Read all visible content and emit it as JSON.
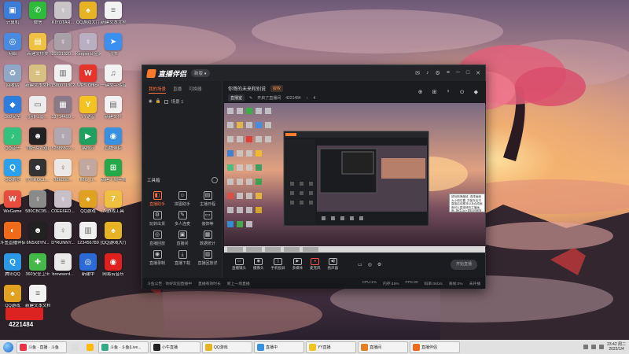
{
  "desktop": {
    "icons": [
      {
        "label": "计算机",
        "color": "#3b7dd8",
        "glyph": "▣"
      },
      {
        "label": "微信",
        "color": "#2dbb3c",
        "glyph": "✆"
      },
      {
        "label": "KIYOTAR...",
        "color": "#c9c3c8",
        "glyph": "♀"
      },
      {
        "label": "QQ游戏大厅",
        "color": "#e6b422",
        "glyph": "♠"
      },
      {
        "label": "新建文本文档",
        "color": "#f2f2f2",
        "glyph": "≡"
      },
      {
        "label": "网络",
        "color": "#4a8ae0",
        "glyph": "◎"
      },
      {
        "label": "新建文件夹",
        "color": "#f0c040",
        "glyph": "▤"
      },
      {
        "label": "20231020...",
        "color": "#aaa0a8",
        "glyph": "♀"
      },
      {
        "label": "Keeper合金装备合集",
        "color": "#b8b0c0",
        "glyph": "♀"
      },
      {
        "label": "飞书",
        "color": "#3a8ff0",
        "glyph": "➤"
      },
      {
        "label": "回收站",
        "color": "#8fa8c8",
        "glyph": "♻"
      },
      {
        "label": "新建文本文档 (2)",
        "color": "#d8c080",
        "glyph": "≡"
      },
      {
        "label": "1580071802",
        "color": "#f0f0f0",
        "glyph": "▥"
      },
      {
        "label": "WPS Office",
        "color": "#e8332a",
        "glyph": "W"
      },
      {
        "label": "一键文字转音频",
        "color": "#f2f2f2",
        "glyph": "♫"
      },
      {
        "label": "360安全",
        "color": "#2c7de0",
        "glyph": "◆"
      },
      {
        "label": "[闪]FL@...",
        "color": "#ececec",
        "glyph": "▭"
      },
      {
        "label": "13714499...",
        "color": "#8a7a88",
        "glyph": "▦"
      },
      {
        "label": "YY语音",
        "color": "#f3c420",
        "glyph": "Y"
      },
      {
        "label": "新建文件",
        "color": "#f2f2f2",
        "glyph": "▤"
      },
      {
        "label": "QQ音乐",
        "color": "#31c27c",
        "glyph": "♪"
      },
      {
        "label": "你好,R7(双)",
        "color": "#222222",
        "glyph": "☻"
      },
      {
        "label": "82888822...",
        "color": "#b0a8b0",
        "glyph": "♀"
      },
      {
        "label": "喀秋莎",
        "color": "#20a060",
        "glyph": "▶"
      },
      {
        "label": "直播伴侣",
        "color": "#3a90e0",
        "glyph": "◉"
      },
      {
        "label": "QQ浏览",
        "color": "#2aa0f0",
        "glyph": "Q"
      },
      {
        "label": "[7%RQCL...",
        "color": "#333333",
        "glyph": "☻"
      },
      {
        "label": "88E858...",
        "color": "#ece8e8",
        "glyph": "♀"
      },
      {
        "label": "IMG_0...",
        "color": "#c0a8a0",
        "glyph": "♀"
      },
      {
        "label": "新建十周年档案",
        "color": "#25a84a",
        "glyph": "⊞"
      },
      {
        "label": "WeGame",
        "color": "#e74c3c",
        "glyph": "W"
      },
      {
        "label": "580CBC95...",
        "color": "#8a8a8a",
        "glyph": "♀"
      },
      {
        "label": "C0EE6ED...",
        "color": "#c8c0c8",
        "glyph": "♀"
      },
      {
        "label": "QQ游戏",
        "color": "#e0a020",
        "glyph": "♠"
      },
      {
        "label": "7k游戏工具",
        "color": "#f0c040",
        "glyph": "7"
      },
      {
        "label": "斗鱼直播伴侣",
        "color": "#f06a1a",
        "glyph": "◐"
      },
      {
        "label": "6N5X8YN...",
        "color": "#222222",
        "glyph": "☻"
      },
      {
        "label": "D*RUNNY...",
        "color": "#eaeaea",
        "glyph": "♀"
      },
      {
        "label": "123456789",
        "color": "#f0f0f0",
        "glyph": "▥"
      },
      {
        "label": "[QQ]游戏大厅(游戏...",
        "color": "#e6b422",
        "glyph": "♠"
      },
      {
        "label": "腾讯QQ",
        "color": "#2a9ae8",
        "glyph": "Q"
      },
      {
        "label": "360安全卫士",
        "color": "#45b84a",
        "glyph": "✚"
      },
      {
        "label": "browserd...",
        "color": "#eaeaea",
        "glyph": "≡"
      },
      {
        "label": "新建中",
        "color": "#2c6ad8",
        "glyph": "◎"
      },
      {
        "label": "网易云音乐",
        "color": "#e0201f",
        "glyph": "◉"
      },
      {
        "label": "QQ游戏",
        "color": "#e0a020",
        "glyph": "♠"
      },
      {
        "label": "新建文本文档",
        "color": "#f2f2f2",
        "glyph": "≡"
      }
    ]
  },
  "app": {
    "name": "直播伴侣",
    "badge": "新版 ●",
    "title_icons": [
      "✉",
      "♪",
      "⚙",
      "≡",
      "─",
      "□",
      "✕"
    ],
    "left_tabs": [
      "我的场景",
      "直播",
      "可换器"
    ],
    "scene_label": "场景 1",
    "tools_title": "工具箱",
    "tools": [
      {
        "label": "直播助手",
        "glyph": "◧",
        "hot": true
      },
      {
        "label": "拼图助手",
        "glyph": "☺",
        "hot": false
      },
      {
        "label": "主播日程",
        "glyph": "▤",
        "hot": false
      },
      {
        "label": "玩转出货",
        "glyph": "⚙",
        "hot": false
      },
      {
        "label": "多人连麦",
        "glyph": "✎",
        "hot": false
      },
      {
        "label": "装饰等",
        "glyph": "▭",
        "hot": false
      },
      {
        "label": "直播回放",
        "glyph": "◎",
        "hot": false
      },
      {
        "label": "直播间",
        "glyph": "▣",
        "hot": false
      },
      {
        "label": "数据统计",
        "glyph": "▦",
        "hot": false
      },
      {
        "label": "直播录制",
        "glyph": "◉",
        "hot": false
      },
      {
        "label": "直播下载",
        "glyph": "⤓",
        "hot": false
      },
      {
        "label": "直播回放详",
        "glyph": "▥",
        "hot": false
      }
    ],
    "header": {
      "title": "你哥的未来和别说",
      "tag": "授权",
      "btn": "直播室",
      "subtitle": "开启了直播间",
      "room_id": "4221484",
      "viewers": "4",
      "icons": [
        "⊕",
        "⊞",
        "♀",
        "⊙",
        "◆"
      ]
    },
    "toolbar": {
      "items": [
        {
          "label": "直播镜头",
          "glyph": "▭",
          "red": false
        },
        {
          "label": "摄像头",
          "glyph": "◉",
          "red": false
        },
        {
          "label": "手机投屏",
          "glyph": "▯",
          "red": false
        },
        {
          "label": "多媒体",
          "glyph": "▶",
          "red": false
        },
        {
          "label": "麦克风",
          "glyph": "♦",
          "red": true
        },
        {
          "label": "扬声器",
          "glyph": "◀)",
          "red": false
        }
      ],
      "right_icons": [
        "▭",
        "◎",
        "⚙"
      ],
      "start_live": "开始直播"
    },
    "status": {
      "left": [
        "斗鱼公告 · 你好欢迎直播中",
        "直播有效时长",
        "新上一场直播"
      ],
      "right": [
        "CPU:1%",
        "内存:45%",
        "FPS:30",
        "码率:0Kb/s",
        "丢帧:0%",
        "未开播"
      ]
    }
  },
  "tooltip": {
    "text": "鼠标拖拽缩放, 选择画面大小和位置, 并保存后可直接启动推流以及合成画面可以直接修改主播画面, 按住Ctrl+鼠标可缩放为画面"
  },
  "overlay": {
    "number": "4221484"
  },
  "taskbar": {
    "tasks": [
      {
        "label": "斗鱼 · 直播 · 斗鱼",
        "color": "#e34"
      },
      {
        "label": "",
        "color": "#ddd"
      },
      {
        "label": "",
        "color": "#fb0"
      },
      {
        "label": "斗鱼 · 斗鱼(Live...",
        "color": "#3a8"
      },
      {
        "label": "小牛直播",
        "color": "#222"
      },
      {
        "label": "QQ游戏",
        "color": "#e6b422"
      },
      {
        "label": "直播中",
        "color": "#3a90e0"
      },
      {
        "label": "YY直播",
        "color": "#f3c420"
      },
      {
        "label": "直播间",
        "color": "#e67e22"
      },
      {
        "label": "直播伴侣",
        "color": "#f06a1a"
      }
    ],
    "time": "23:42 周二",
    "date": "2022/1/4"
  }
}
